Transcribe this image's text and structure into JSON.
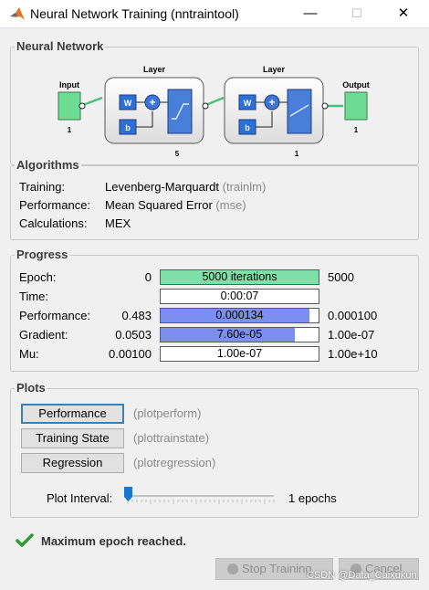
{
  "window": {
    "title": "Neural Network Training (nntraintool)",
    "minimize": "—",
    "maximize": "☐",
    "close": "✕"
  },
  "network": {
    "group_label": "Neural Network",
    "input_label": "Input",
    "input_size": "1",
    "hidden_layer_label": "Layer",
    "hidden_size": "5",
    "output_layer_label": "Layer",
    "output_layer_size": "1",
    "output_label": "Output",
    "output_size": "1",
    "weight_label": "W",
    "bias_label": "b",
    "sum_label": "+"
  },
  "algorithms": {
    "group_label": "Algorithms",
    "rows": [
      {
        "label": "Training:",
        "value": "Levenberg-Marquardt",
        "code": "(trainlm)"
      },
      {
        "label": "Performance:",
        "value": "Mean Squared Error",
        "code": "(mse)"
      },
      {
        "label": "Calculations:",
        "value": "MEX",
        "code": ""
      }
    ]
  },
  "progress": {
    "group_label": "Progress",
    "rows": [
      {
        "label": "Epoch:",
        "start": "0",
        "current": "5000 iterations",
        "end": "5000",
        "fill": 1.0,
        "color": "#7ee0a8"
      },
      {
        "label": "Time:",
        "start": "",
        "current": "0:00:07",
        "end": "",
        "fill": 0.0,
        "color": "#ffffff"
      },
      {
        "label": "Performance:",
        "start": "0.483",
        "current": "0.000134",
        "end": "0.000100",
        "fill": 0.94,
        "color": "#7b8ff0"
      },
      {
        "label": "Gradient:",
        "start": "0.0503",
        "current": "7.60e-05",
        "end": "1.00e-07",
        "fill": 0.85,
        "color": "#7b8ff0"
      },
      {
        "label": "Mu:",
        "start": "0.00100",
        "current": "1.00e-07",
        "end": "1.00e+10",
        "fill": 0.0,
        "color": "#ffffff"
      }
    ]
  },
  "plots": {
    "group_label": "Plots",
    "buttons": [
      {
        "label": "Performance",
        "code": "(plotperform)"
      },
      {
        "label": "Training State",
        "code": "(plottrainstate)"
      },
      {
        "label": "Regression",
        "code": "(plotregression)"
      }
    ],
    "interval_label": "Plot Interval:",
    "interval_value": "1 epochs",
    "interval_fraction": 0.0
  },
  "status": {
    "message": "Maximum epoch reached."
  },
  "footer": {
    "stop_label": "Stop Training",
    "cancel_label": "Cancel",
    "watermark": "CSDN @Data_Caixukun"
  },
  "colors": {
    "accent": "#3c7fb1",
    "epoch_fill": "#7ee0a8",
    "perf_fill": "#7b8ff0",
    "check": "#2d9a32"
  }
}
